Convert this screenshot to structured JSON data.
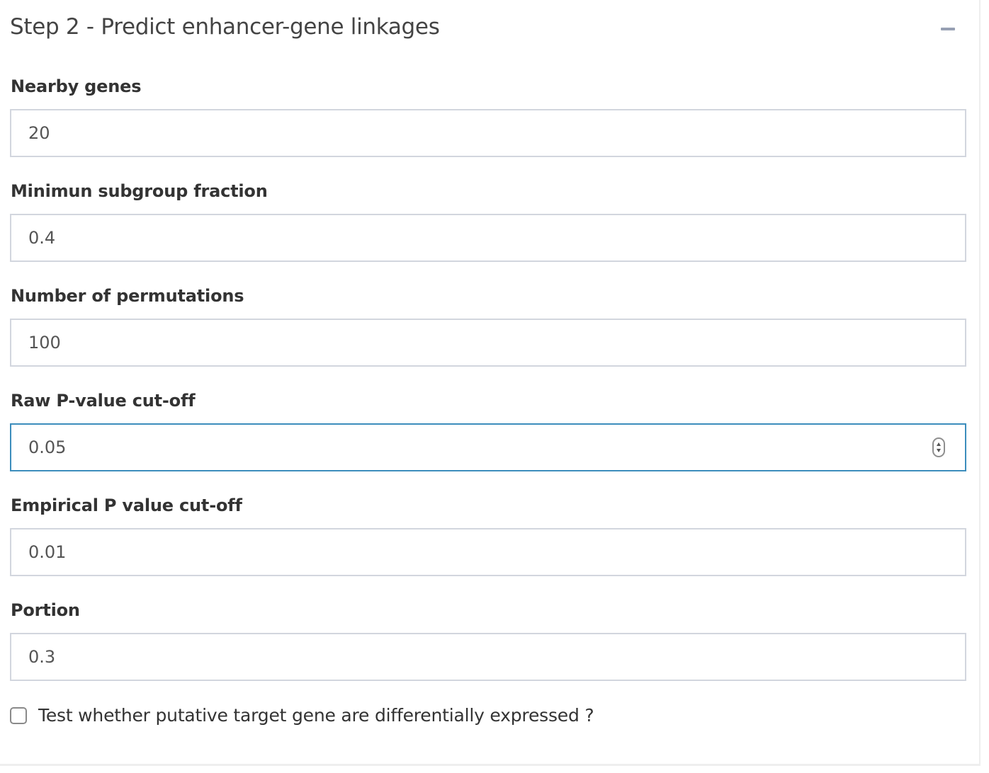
{
  "panel": {
    "title": "Step 2 - Predict enhancer-gene linkages",
    "collapse_icon": "minus-icon"
  },
  "fields": {
    "nearby_genes": {
      "label": "Nearby genes",
      "value": "20"
    },
    "min_subgroup_fraction": {
      "label": "Minimun subgroup fraction",
      "value": "0.4"
    },
    "num_permutations": {
      "label": "Number of permutations",
      "value": "100"
    },
    "raw_pvalue_cutoff": {
      "label": "Raw P-value cut-off",
      "value": "0.05"
    },
    "empirical_pvalue_cutoff": {
      "label": "Empirical P value cut-off",
      "value": "0.01"
    },
    "portion": {
      "label": "Portion",
      "value": "0.3"
    }
  },
  "checkbox": {
    "label": "Test whether putative target gene are differentially expressed ?",
    "checked": false
  },
  "colors": {
    "focus_border": "#3c8dbc",
    "input_border": "#d2d6de",
    "collapse_icon": "#97a0b3"
  }
}
